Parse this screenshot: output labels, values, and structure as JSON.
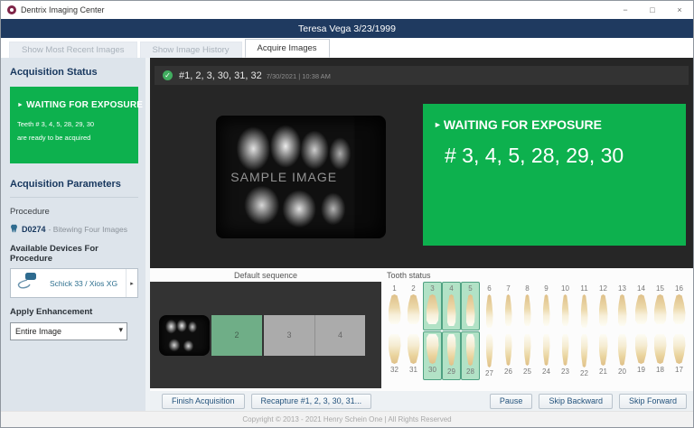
{
  "colors": {
    "accent_green": "#0db14e",
    "header_navy": "#1f3a60",
    "tooth_highlight_bg": "#b2e2c6",
    "tooth_highlight_border": "#4fa182",
    "active_slot_green": "#6fae87"
  },
  "icons": {
    "check": "✓",
    "play_arrow": "►",
    "device_arrow": "▸",
    "select_chevron": "▾",
    "minimize": "−",
    "maximize": "□",
    "close": "×"
  },
  "window": {
    "title": "Dentrix Imaging Center"
  },
  "patient_bar": {
    "text": "Teresa Vega 3/23/1999"
  },
  "tabs": [
    {
      "label": "Show Most Recent Images",
      "active": false
    },
    {
      "label": "Show Image History",
      "active": false
    },
    {
      "label": "Acquire Images",
      "active": true
    }
  ],
  "sidebar": {
    "status_heading": "Acquisition Status",
    "status_box": {
      "title": "WAITING FOR EXPOSURE",
      "line1": "Teeth # 3, 4, 5, 28, 29, 30",
      "line2": "are ready to be acquired"
    },
    "params_heading": "Acquisition Parameters",
    "procedure_label": "Procedure",
    "procedure_code": "D0274",
    "procedure_separator": "-",
    "procedure_name": "Bitewing Four Images",
    "devices_label": "Available Devices For Procedure",
    "device_name": "Schick 33 / Xios XG",
    "enhancement_label": "Apply Enhancement",
    "enhancement_value": "Entire Image"
  },
  "viewer": {
    "image_title": "#1, 2, 3, 30, 31, 32",
    "image_timestamp": "7/30/2021 | 10:38 AM",
    "watermark": "SAMPLE IMAGE",
    "status_title": "WAITING FOR EXPOSURE",
    "status_teeth": "# 3, 4, 5, 28, 29, 30"
  },
  "sequence": {
    "label": "Default sequence",
    "slots": [
      {
        "type": "image",
        "label": ""
      },
      {
        "type": "active",
        "label": "2"
      },
      {
        "type": "pending",
        "label": "3"
      },
      {
        "type": "pending",
        "label": "4"
      }
    ]
  },
  "tooth_status": {
    "label": "Tooth status",
    "top_row": [
      1,
      2,
      3,
      4,
      5,
      6,
      7,
      8,
      9,
      10,
      11,
      12,
      13,
      14,
      15,
      16
    ],
    "bottom_row": [
      32,
      31,
      30,
      29,
      28,
      27,
      26,
      25,
      24,
      23,
      22,
      21,
      20,
      19,
      18,
      17
    ],
    "highlighted": [
      3,
      4,
      5,
      28,
      29,
      30
    ],
    "types": {
      "molar": [
        1,
        2,
        3,
        14,
        15,
        16,
        17,
        18,
        19,
        30,
        31,
        32
      ],
      "premolar": [
        4,
        5,
        12,
        13,
        20,
        21,
        28,
        29
      ],
      "canine": [
        6,
        11,
        22,
        27
      ],
      "incisor": [
        7,
        8,
        9,
        10,
        23,
        24,
        25,
        26
      ]
    }
  },
  "actions": {
    "finish": "Finish Acquisition",
    "recapture": "Recapture #1, 2, 3, 30, 31...",
    "pause": "Pause",
    "skip_backward": "Skip Backward",
    "skip_forward": "Skip Forward"
  },
  "footer": {
    "copyright": "Copyright © 2013 - 2021 Henry Schein One | All Rights Reserved"
  }
}
